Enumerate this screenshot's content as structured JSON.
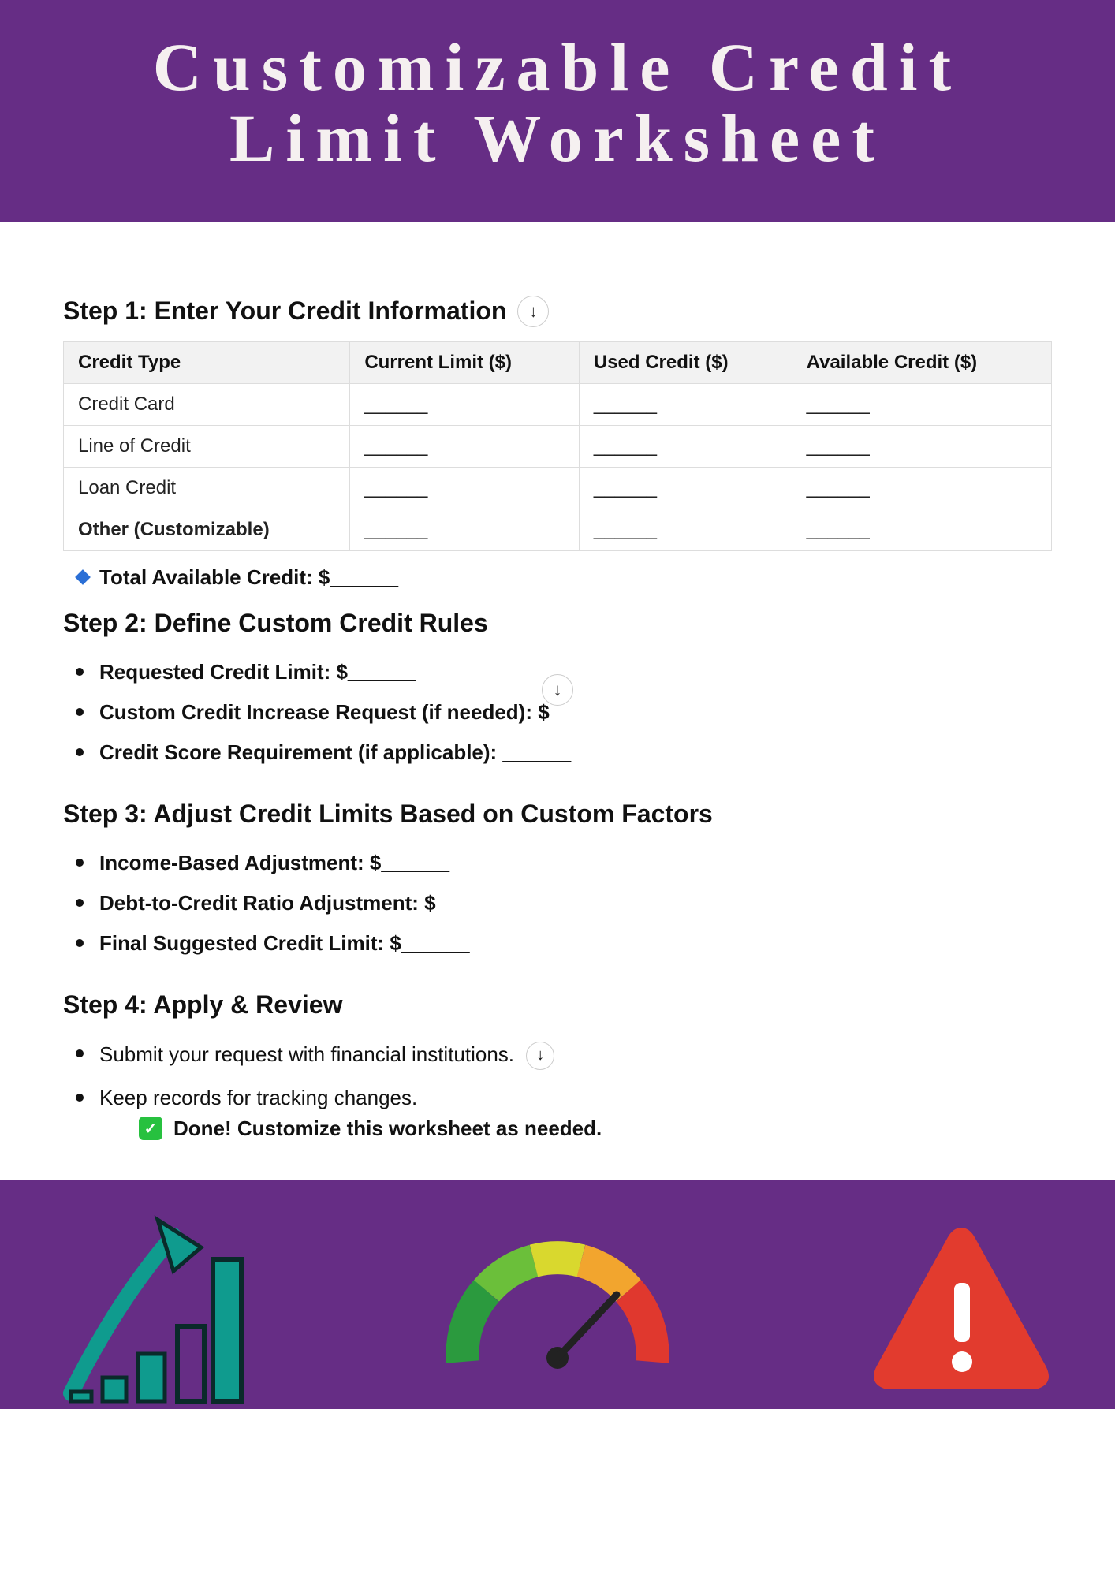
{
  "header": {
    "title_line1": "Customizable Credit",
    "title_line2": "Limit Worksheet"
  },
  "blank": "______",
  "step1": {
    "title": "Step 1: Enter Your Credit Information",
    "headers": [
      "Credit Type",
      "Current Limit ($)",
      "Used Credit ($)",
      "Available Credit ($)"
    ],
    "rows": [
      "Credit Card",
      "Line of Credit",
      "Loan Credit",
      "Other (Customizable)"
    ],
    "total": "Total Available Credit: $______"
  },
  "step2": {
    "title": "Step 2: Define Custom Credit Rules",
    "items": [
      "Requested Credit Limit: $______",
      "Custom Credit Increase Request (if needed): $______",
      "Credit Score Requirement (if applicable): ______"
    ]
  },
  "step3": {
    "title": "Step 3: Adjust Credit Limits Based on Custom Factors",
    "items": [
      "Income-Based Adjustment: $______",
      "Debt-to-Credit Ratio Adjustment: $______",
      "Final Suggested Credit Limit: $______"
    ]
  },
  "step4": {
    "title": "Step 4: Apply & Review",
    "items": [
      "Submit your request with financial institutions.",
      "Keep records for tracking changes."
    ],
    "done": "Done! Customize this worksheet as needed."
  }
}
